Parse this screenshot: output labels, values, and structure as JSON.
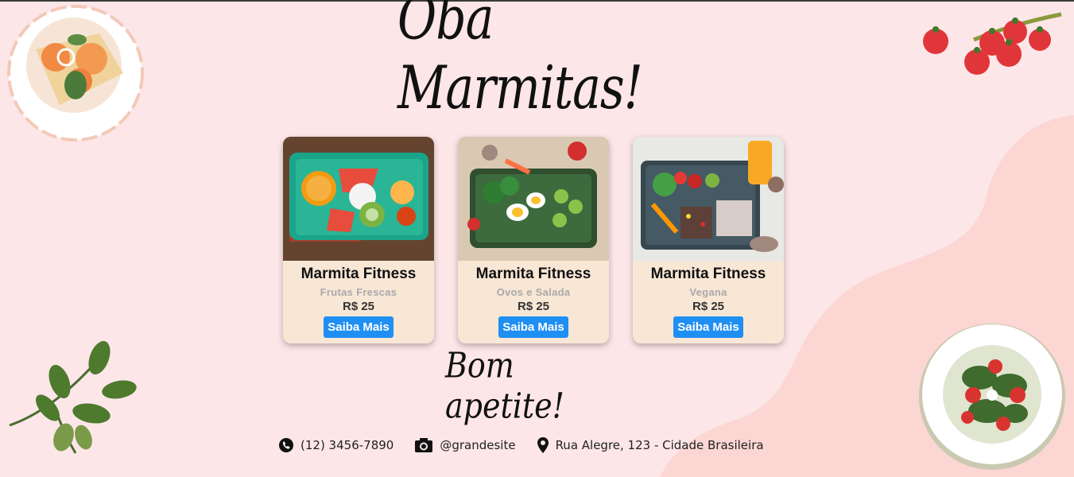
{
  "title": "Oba Marmitas!",
  "cards": [
    {
      "name": "Marmita Fitness",
      "subtitle": "Frutas Frescas",
      "price": "R$ 25",
      "button": "Saiba Mais"
    },
    {
      "name": "Marmita Fitness",
      "subtitle": "Ovos e Salada",
      "price": "R$ 25",
      "button": "Saiba Mais"
    },
    {
      "name": "Marmita Fitness",
      "subtitle": "Vegana",
      "price": "R$ 25",
      "button": "Saiba Mais"
    }
  ],
  "closing": "Bom apetite!",
  "footer": {
    "phone": "(12) 3456-7890",
    "instagram": "@grandesite",
    "address": "Rua Alegre, 123 - Cidade Brasileira"
  },
  "icons": [
    "phone-icon",
    "camera-icon",
    "location-pin-icon"
  ],
  "colors": {
    "background": "#fde6e8",
    "card": "#f9e7d6",
    "button": "#1f8ff3",
    "blob": "#fbd6d3"
  }
}
